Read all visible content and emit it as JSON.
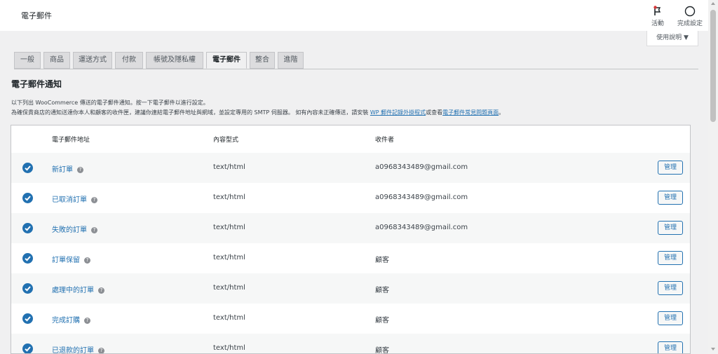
{
  "header": {
    "title": "電子郵件",
    "activity_label": "活動",
    "setup_label": "完成設定",
    "help_label": "使用說明 ▼"
  },
  "tabs": [
    {
      "label": "一般"
    },
    {
      "label": "商品"
    },
    {
      "label": "運送方式"
    },
    {
      "label": "付款"
    },
    {
      "label": "帳號及隱私權"
    },
    {
      "label": "電子郵件",
      "active": true
    },
    {
      "label": "整合"
    },
    {
      "label": "進階"
    }
  ],
  "section": {
    "heading": "電子郵件通知",
    "desc1": "以下列出 WooCommerce 傳送的電子郵件通知。按一下電子郵件以進行設定。",
    "desc2_pre": "為確保貴商店的通知送達你本人和顧客的收件匣，建議你連結電子郵件地址與網域，並設定專用的 SMTP 伺服器。 如有內容未正確傳送，請安裝 ",
    "desc2_link1": "WP 郵件記錄外掛程式",
    "desc2_mid": "或查看",
    "desc2_link2": "電子郵件常見問題頁面",
    "desc2_post": "。"
  },
  "table": {
    "headers": {
      "email": "電子郵件地址",
      "content_type": "內容型式",
      "recipient": "收件者"
    },
    "manage_label": "管理",
    "help_glyph": "?",
    "rows": [
      {
        "name": "新訂單",
        "type": "text/html",
        "recipient": "a0968343489@gmail.com"
      },
      {
        "name": "已取消訂單",
        "type": "text/html",
        "recipient": "a0968343489@gmail.com"
      },
      {
        "name": "失敗的訂單",
        "type": "text/html",
        "recipient": "a0968343489@gmail.com"
      },
      {
        "name": "訂單保留",
        "type": "text/html",
        "recipient": "顧客"
      },
      {
        "name": "處理中的訂單",
        "type": "text/html",
        "recipient": "顧客"
      },
      {
        "name": "完成訂購",
        "type": "text/html",
        "recipient": "顧客"
      },
      {
        "name": "已退款的訂單",
        "type": "text/html",
        "recipient": "顧客"
      }
    ]
  },
  "colors": {
    "accent": "#2271b1",
    "background": "#f0f0f1",
    "notice_dot": "#d63638"
  }
}
